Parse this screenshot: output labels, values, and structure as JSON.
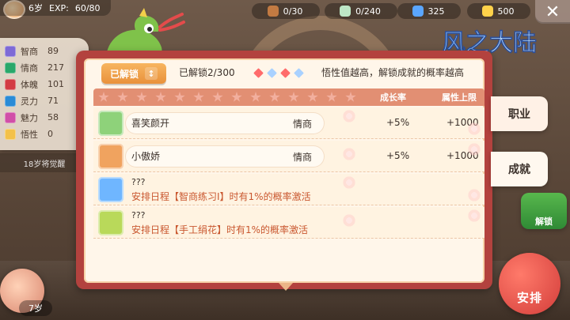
{
  "player": {
    "age_label": "6岁",
    "exp_label": "EXP:",
    "exp_value": "60/80"
  },
  "stats": [
    {
      "label": "智商",
      "value": "89",
      "color": "#7e6ad6"
    },
    {
      "label": "情商",
      "value": "217",
      "color": "#2aa86a"
    },
    {
      "label": "体魄",
      "value": "101",
      "color": "#d33b43"
    },
    {
      "label": "灵力",
      "value": "71",
      "color": "#2a8bd6"
    },
    {
      "label": "魅力",
      "value": "58",
      "color": "#d14fa8"
    },
    {
      "label": "悟性",
      "value": "0",
      "color": "#f3c14a"
    }
  ],
  "stats_footer": "18岁将觉醒",
  "resources": [
    {
      "name": "wood",
      "value": "0/30",
      "icon": "log-icon",
      "color": "#c27a42"
    },
    {
      "name": "cloth",
      "value": "0/240",
      "icon": "cloth-icon",
      "color": "#bde7c6"
    },
    {
      "name": "energy",
      "value": "325",
      "icon": "lightning-icon",
      "color": "#5aa6ff"
    },
    {
      "name": "happiness",
      "value": "500",
      "icon": "smile-icon",
      "color": "#ffd24a"
    }
  ],
  "logo_text": "风之大陆",
  "panel": {
    "unlock_button": "已解锁",
    "unlock_sort_glyph": "↕",
    "unlocked_count": "已解锁2/300",
    "hint": "悟性值越高，解锁成就的概率越高",
    "diamond_colors": [
      "#ff6b6b",
      "#a9d1ff",
      "#ff6b6b",
      "#a9d1ff"
    ],
    "headers": {
      "growth_rate": "成长率",
      "attr_cap": "属性上限"
    },
    "rows": [
      {
        "type": "unlocked",
        "name": "喜笑颜开",
        "attr": "情商",
        "rate": "+5%",
        "cap": "+1000",
        "icon": "cat-face-icon"
      },
      {
        "type": "unlocked",
        "name": "小傲娇",
        "attr": "情商",
        "rate": "+5%",
        "cap": "+1000",
        "icon": "shy-cat-icon"
      },
      {
        "type": "locked",
        "q": "???",
        "desc": "安排日程【智商练习Ⅰ】时有1%的概率激活",
        "icon": "lightbulb-icon"
      },
      {
        "type": "locked",
        "q": "???",
        "desc": "安排日程【手工绢花】时有1%的概率激活",
        "icon": "flower-box-icon"
      }
    ]
  },
  "side_tabs": {
    "career": "职业",
    "achievement": "成就"
  },
  "right_buttons": {
    "unlock": "解锁",
    "schedule": "安排"
  },
  "bottom": {
    "age_label": "7岁"
  }
}
